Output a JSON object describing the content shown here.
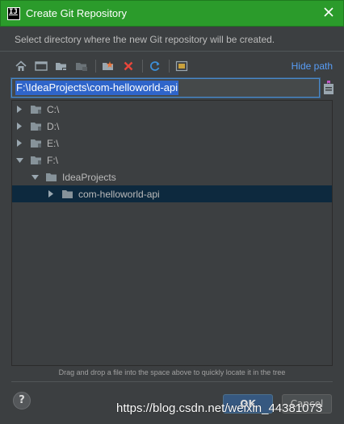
{
  "window": {
    "title": "Create Git Repository",
    "app_icon_text": "IJ"
  },
  "description": "Select directory where the new Git repository will be created.",
  "toolbar": {
    "buttons": [
      {
        "icon": "home-icon"
      },
      {
        "icon": "desktop-icon"
      },
      {
        "icon": "project-folder-icon"
      },
      {
        "icon": "module-folder-icon"
      },
      {
        "icon": "new-folder-icon"
      },
      {
        "icon": "delete-icon"
      },
      {
        "icon": "refresh-icon"
      },
      {
        "icon": "show-hidden-icon"
      }
    ],
    "hide_path_label": "Hide path"
  },
  "path_field": {
    "value": "F:\\IdeaProjects\\com-helloworld-api"
  },
  "tree": {
    "items": [
      {
        "label": "C:\\",
        "depth": 0,
        "expanded": false,
        "selected": false,
        "type": "drive"
      },
      {
        "label": "D:\\",
        "depth": 0,
        "expanded": false,
        "selected": false,
        "type": "drive"
      },
      {
        "label": "E:\\",
        "depth": 0,
        "expanded": false,
        "selected": false,
        "type": "drive"
      },
      {
        "label": "F:\\",
        "depth": 0,
        "expanded": true,
        "selected": false,
        "type": "drive"
      },
      {
        "label": "IdeaProjects",
        "depth": 1,
        "expanded": true,
        "selected": false,
        "type": "folder"
      },
      {
        "label": "com-helloworld-api",
        "depth": 2,
        "expanded": false,
        "selected": true,
        "type": "folder"
      }
    ]
  },
  "hint": "Drag and drop a file into the space above to quickly locate it in the tree",
  "buttons": {
    "help": "?",
    "ok": "OK",
    "cancel": "Cancel"
  },
  "watermark": "https://blog.csdn.net/weixin_44381073",
  "colors": {
    "titlebar": "#2b9b2b",
    "background": "#3c3f41",
    "selection": "#0d293e",
    "link": "#589df6",
    "ok_button": "#365880"
  }
}
